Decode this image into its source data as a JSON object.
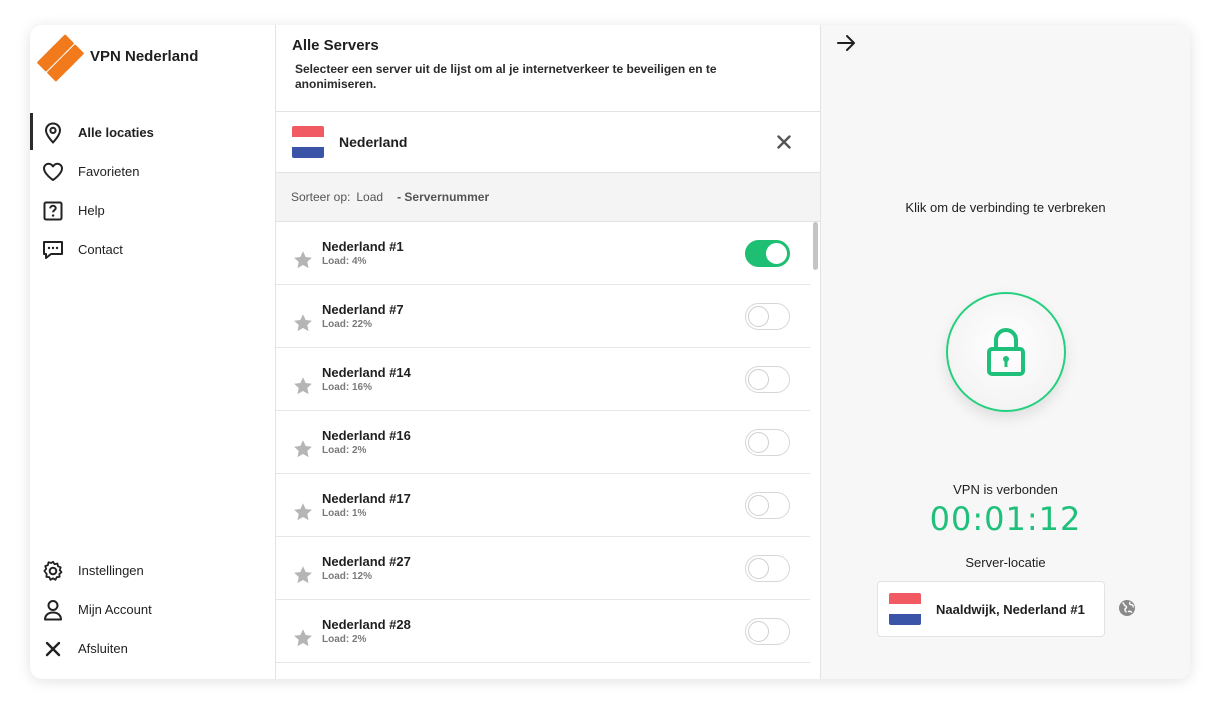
{
  "app": {
    "title": "VPN Nederland",
    "accent": "#f07a1c",
    "success": "#1fbf73"
  },
  "sidebar": {
    "items": [
      {
        "label": "Alle locaties",
        "icon": "location-pin-icon",
        "active": true
      },
      {
        "label": "Favorieten",
        "icon": "heart-icon"
      },
      {
        "label": "Help",
        "icon": "help-icon"
      },
      {
        "label": "Contact",
        "icon": "chat-icon"
      }
    ],
    "bottom_items": [
      {
        "label": "Instellingen",
        "icon": "gear-icon"
      },
      {
        "label": "Mijn Account",
        "icon": "user-icon"
      },
      {
        "label": "Afsluiten",
        "icon": "close-icon"
      }
    ]
  },
  "servers": {
    "title": "Alle Servers",
    "description": "Selecteer een server uit de lijst om al je internetverkeer te beveiligen en te anonimiseren.",
    "country": "Nederland",
    "sort": {
      "label": "Sorteer op:",
      "option1": "Load",
      "option2": "- Servernummer"
    },
    "list": [
      {
        "name": "Nederland #1",
        "load": "Load: 4%",
        "connected": true
      },
      {
        "name": "Nederland #7",
        "load": "Load: 22%",
        "connected": false
      },
      {
        "name": "Nederland #14",
        "load": "Load: 16%",
        "connected": false
      },
      {
        "name": "Nederland #16",
        "load": "Load: 2%",
        "connected": false
      },
      {
        "name": "Nederland #17",
        "load": "Load: 1%",
        "connected": false
      },
      {
        "name": "Nederland #27",
        "load": "Load: 12%",
        "connected": false
      },
      {
        "name": "Nederland #28",
        "load": "Load: 2%",
        "connected": false
      }
    ]
  },
  "status": {
    "hint": "Klik om de verbinding te verbreken",
    "state": "VPN is verbonden",
    "timer": "00:01:12",
    "location_label": "Server-locatie",
    "location": "Naaldwijk, Nederland #1"
  }
}
